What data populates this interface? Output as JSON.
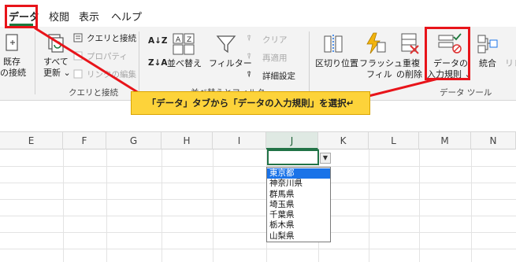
{
  "menu": {
    "tabs": [
      {
        "label": "データ",
        "active": true
      },
      {
        "label": "校閲"
      },
      {
        "label": "表示"
      },
      {
        "label": "ヘルプ"
      }
    ]
  },
  "ribbon": {
    "get_data": {
      "label_line1": "既存",
      "label_line2": "の接続"
    },
    "refresh": {
      "label_line1": "すべて",
      "label_line2": "更新 ⌄"
    },
    "queries": {
      "connections": "クエリと接続",
      "properties": "プロパティ",
      "edit_links": "リンクの編集",
      "group_label": "クエリと接続"
    },
    "sort": {
      "label": "並べ替え"
    },
    "filter": {
      "label": "フィルター",
      "clear": "クリア",
      "reapply": "再適用",
      "advanced": "詳細設定",
      "group_label": "並べ替えとフィルター"
    },
    "tools": {
      "text_to_columns": "区切り位置",
      "flash_fill_line1": "フラッシュ",
      "flash_fill_line2": "フィル",
      "remove_dup_line1": "重複",
      "remove_dup_line2": "の削除",
      "validation_line1": "データの",
      "validation_line2": "入力規則 ⌄",
      "consolidate": "統合",
      "relationships": "リレ",
      "group_label": "データ ツール"
    }
  },
  "columns": [
    "E",
    "F",
    "G",
    "H",
    "I",
    "J",
    "K",
    "L",
    "M",
    "N"
  ],
  "dropdown": {
    "items": [
      "東京都",
      "神奈川県",
      "群馬県",
      "埼玉県",
      "千葉県",
      "栃木県",
      "山梨県"
    ],
    "selected_index": 0
  },
  "callout": {
    "text": "「データ」タブから「データの入力規則」を選択↵"
  },
  "colors": {
    "highlight": "#e8141a",
    "callout_bg": "#fdd33a",
    "excel_green": "#217346",
    "list_selection": "#1a73e8"
  }
}
